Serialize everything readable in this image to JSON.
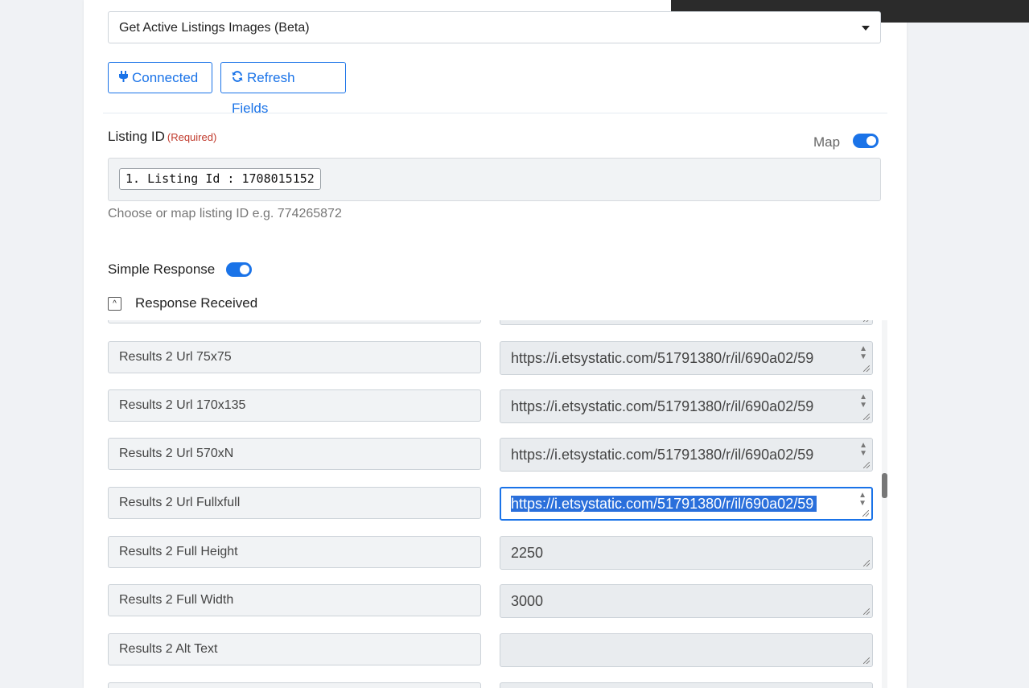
{
  "action_select": {
    "value": "Get Active Listings Images (Beta)"
  },
  "buttons": {
    "connected": "Connected",
    "refresh": "Refresh Fields"
  },
  "listing_id": {
    "label": "Listing ID",
    "required": "(Required)",
    "map_label": "Map",
    "map_enabled": true,
    "chip": "1. Listing Id : 1708015152",
    "hint": "Choose or map listing ID e.g. 774265872"
  },
  "simple_response": {
    "label": "Simple Response",
    "enabled": true
  },
  "response": {
    "label": "Response Received",
    "collapse_glyph": "^"
  },
  "rows": [
    {
      "key": "Results 2 Url 75x75",
      "value": "https://i.etsystatic.com/51791380/r/il/690a02/59"
    },
    {
      "key": "Results 2 Url 170x135",
      "value": "https://i.etsystatic.com/51791380/r/il/690a02/59"
    },
    {
      "key": "Results 2 Url 570xN",
      "value": "https://i.etsystatic.com/51791380/r/il/690a02/59"
    },
    {
      "key": "Results 2 Url Fullxfull",
      "value": "https://i.etsystatic.com/51791380/r/il/690a02/59"
    },
    {
      "key": "Results 2 Full Height",
      "value": "2250"
    },
    {
      "key": "Results 2 Full Width",
      "value": "3000"
    },
    {
      "key": "Results 2 Alt Text",
      "value": ""
    }
  ],
  "colors": {
    "accent": "#1a73e8",
    "required": "#c0392b",
    "selection": "#2a6fdb"
  },
  "icons": {
    "connected": "plug-icon",
    "refresh": "refresh-icon"
  }
}
